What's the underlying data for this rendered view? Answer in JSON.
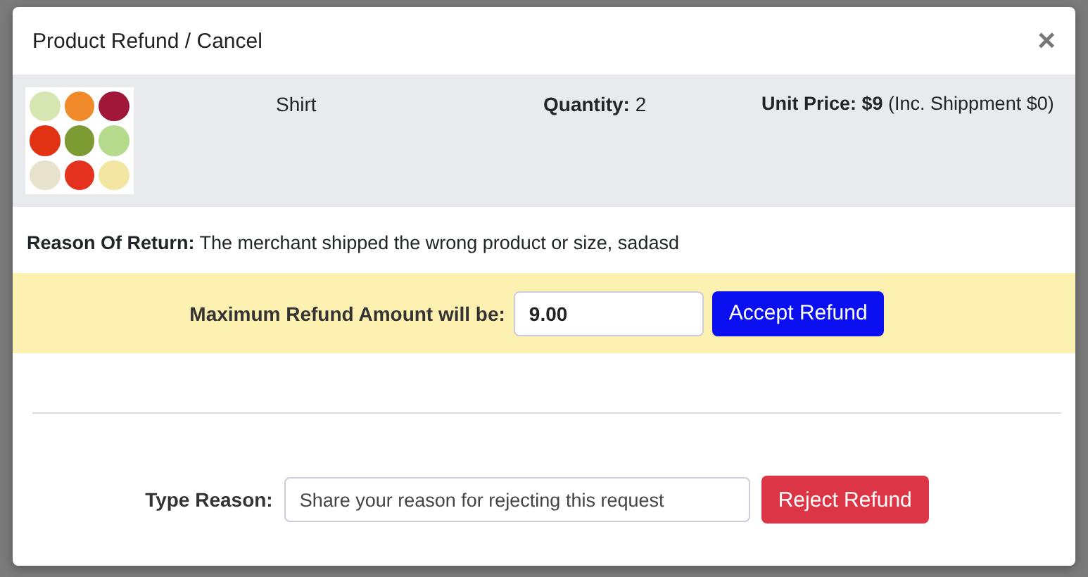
{
  "modal": {
    "title": "Product Refund / Cancel",
    "close": "×"
  },
  "product": {
    "name": "Shirt",
    "quantity": "**Quantity:** 2",
    "price": "**Unit Price: $9** (Inc. Shippment $0)"
  },
  "reason": "**Reason Of Return:** The merchant shipped the wrong product or size, sadasd",
  "accept": {
    "label": "Maximum Refund Amount will be:",
    "value": "9.00",
    "button": "Accept Refund"
  },
  "reject": {
    "label": "Type Reason:",
    "placeholder": "Share your reason for rejecting this request",
    "button": "Reject Refund"
  }
}
